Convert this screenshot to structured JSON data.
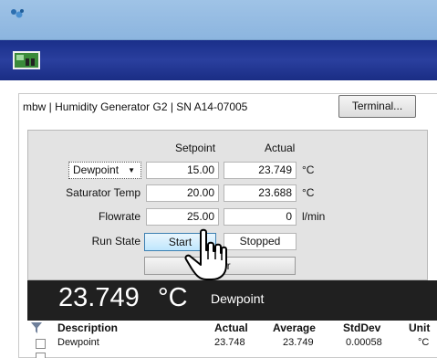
{
  "header": {
    "device_title": "mbw | Humidity Generator G2 | SN A14-07005",
    "terminal_button": "Terminal..."
  },
  "controls": {
    "col_setpoint": "Setpoint",
    "col_actual": "Actual",
    "rows": [
      {
        "label": "Dewpoint",
        "setpoint": "15.00",
        "actual": "23.749",
        "unit": "°C"
      },
      {
        "label": "Saturator Temp",
        "setpoint": "20.00",
        "actual": "23.688",
        "unit": "°C"
      },
      {
        "label": "Flowrate",
        "setpoint": "25.00",
        "actual": "0",
        "unit": "l/min"
      }
    ],
    "run_state_label": "Run State",
    "start_button": "Start",
    "run_state_value": "Stopped",
    "wide_button_visible_text": "er"
  },
  "readout": {
    "value": "23.749",
    "unit": "°C",
    "label": "Dewpoint"
  },
  "table": {
    "headers": [
      "Description",
      "Actual",
      "Average",
      "StdDev",
      "Unit"
    ],
    "rows": [
      {
        "description": "Dewpoint",
        "actual": "23.748",
        "average": "23.749",
        "stddev": "0.00058",
        "unit": "°C"
      }
    ]
  },
  "colors": {
    "banner": "#1a2f8a",
    "titlebar": "#9fc3e6",
    "readout_bg": "#202020",
    "start_button": "#bee6fd"
  }
}
